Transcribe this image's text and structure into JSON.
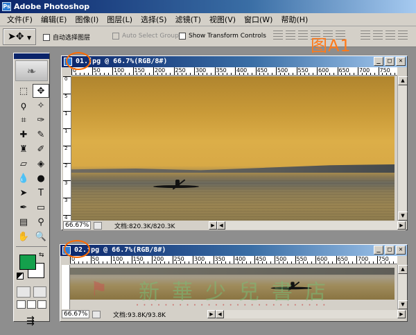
{
  "app": {
    "title": "Adobe Photoshop"
  },
  "menu": [
    "文件(F)",
    "编辑(E)",
    "图像(I)",
    "图层(L)",
    "选择(S)",
    "滤镜(T)",
    "视图(V)",
    "窗口(W)",
    "帮助(H)"
  ],
  "figure_label": "图A1",
  "options": {
    "auto_select_layer": "自动选择图层",
    "auto_select_groups": "Auto Select Groups",
    "show_transform_controls": "Show Transform Controls"
  },
  "doc1": {
    "title": "01.jpg @ 66.7%(RGB/8#)",
    "ruler_h": [
      "0",
      "50",
      "100",
      "150",
      "200",
      "250",
      "300",
      "350",
      "400",
      "450",
      "500",
      "550",
      "600",
      "650",
      "700",
      "750"
    ],
    "ruler_v": [
      "0",
      "5",
      "1",
      "1",
      "2",
      "2",
      "3",
      "3",
      "4"
    ],
    "zoom": "66.67%",
    "info": "文档:820.3K/820.3K"
  },
  "doc2": {
    "title": "02.jpg @ 66.7%(RGB/8#)",
    "ruler_h": [
      "0",
      "50",
      "100",
      "150",
      "200",
      "250",
      "300",
      "350",
      "400",
      "450",
      "500",
      "550",
      "600",
      "650",
      "700",
      "750"
    ],
    "zoom": "66.67%",
    "info": "文档:93.8K/93.8K"
  },
  "watermark": "新華少兒書店",
  "colors": {
    "foreground": "#14a04c",
    "background": "#ffffff",
    "annotation": "#ff6a00"
  }
}
